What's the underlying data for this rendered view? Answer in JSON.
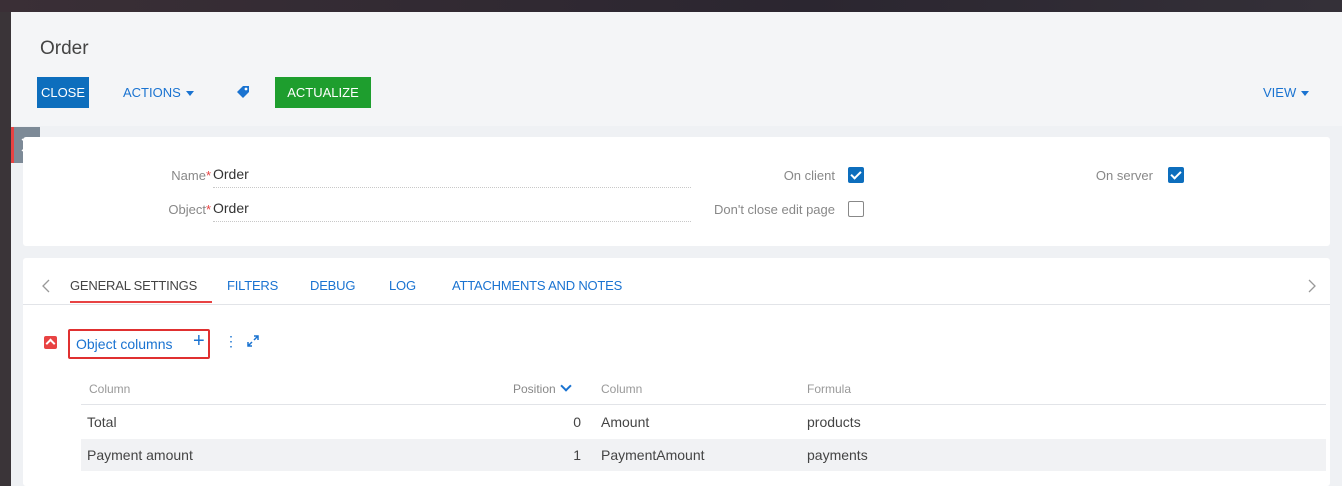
{
  "header": {
    "title": "Order",
    "close_label": "CLOSE",
    "actions_label": "ACTIONS",
    "actualize_label": "ACTUALIZE",
    "view_label": "VIEW"
  },
  "form": {
    "name_label": "Name",
    "name_value": "Order",
    "object_label": "Object",
    "object_value": "Order",
    "required_mark": "*",
    "on_client_label": "On client",
    "on_client_checked": true,
    "dont_close_label": "Don't close edit page",
    "dont_close_checked": false,
    "on_server_label": "On server",
    "on_server_checked": true
  },
  "tabs": [
    {
      "label": "GENERAL SETTINGS",
      "active": true
    },
    {
      "label": "FILTERS",
      "active": false
    },
    {
      "label": "DEBUG",
      "active": false
    },
    {
      "label": "LOG",
      "active": false
    },
    {
      "label": "ATTACHMENTS AND NOTES",
      "active": false
    }
  ],
  "detail": {
    "title": "Object columns",
    "plus": "+",
    "menu": "⋮"
  },
  "table": {
    "headers": [
      "Column",
      "Position",
      "Column",
      "Formula"
    ],
    "rows": [
      {
        "column": "Total",
        "position": "0",
        "target": "Amount",
        "formula": "products"
      },
      {
        "column": "Payment amount",
        "position": "1",
        "target": "PaymentAmount",
        "formula": "payments"
      }
    ]
  },
  "colors": {
    "primary": "#0d6ebd",
    "success": "#1e9e2e",
    "accent": "#e84343",
    "link": "#1a73d1"
  },
  "icons": [
    "tag-icon",
    "chevron-right-icon",
    "chevron-left-icon",
    "collapse-icon",
    "plus-icon",
    "kebab-menu-icon",
    "expand-icon",
    "sort-down-icon"
  ]
}
